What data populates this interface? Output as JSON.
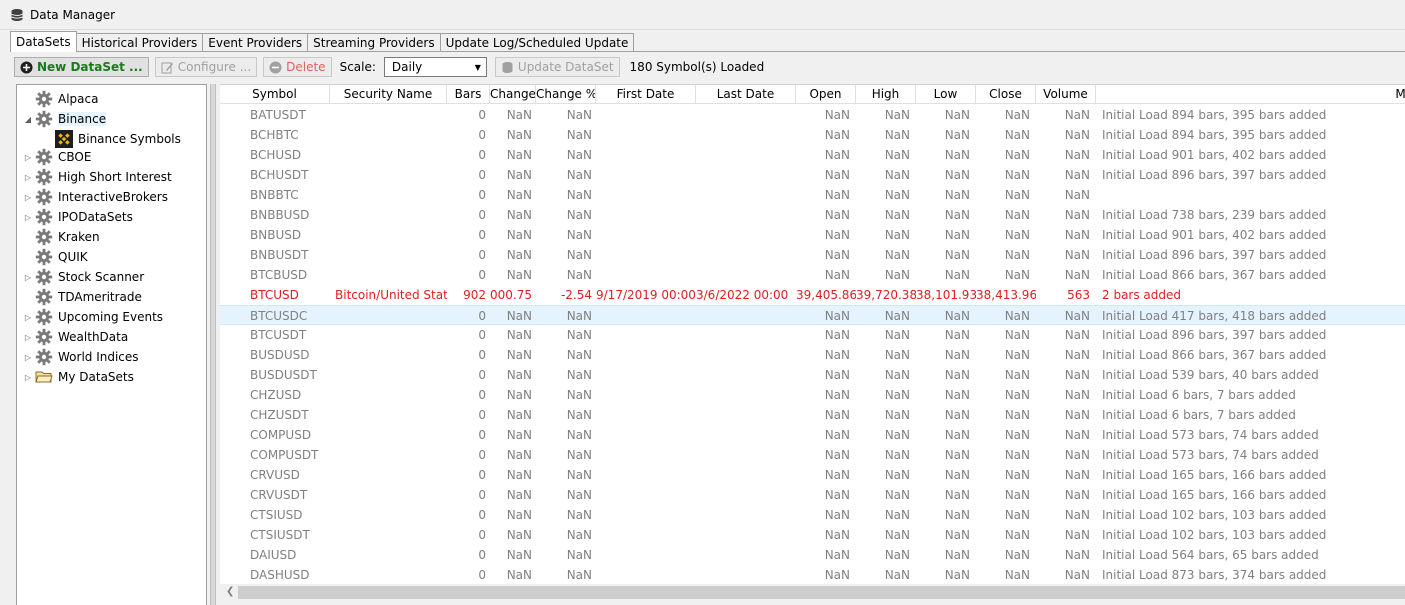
{
  "window": {
    "title": "Data Manager"
  },
  "tabs": [
    {
      "label": "DataSets",
      "active": true
    },
    {
      "label": "Historical Providers",
      "active": false
    },
    {
      "label": "Event Providers",
      "active": false
    },
    {
      "label": "Streaming Providers",
      "active": false
    },
    {
      "label": "Update Log/Scheduled Update",
      "active": false
    }
  ],
  "toolbar": {
    "new_label": "New DataSet ...",
    "configure_label": "Configure ...",
    "delete_label": "Delete",
    "scale_label": "Scale:",
    "scale_value": "Daily",
    "update_label": "Update DataSet",
    "status": "180 Symbol(s) Loaded"
  },
  "tree": {
    "items": [
      {
        "label": "Alpaca",
        "icon": "gear-icon",
        "expander": ""
      },
      {
        "label": "Binance",
        "icon": "gear-icon",
        "expander": "expanded",
        "selected": true
      },
      {
        "label": "Binance Symbols",
        "icon": "binance-logo-icon",
        "expander": "",
        "child": true
      },
      {
        "label": "CBOE",
        "icon": "gear-icon",
        "expander": "collapsed"
      },
      {
        "label": "High Short Interest",
        "icon": "gear-icon",
        "expander": "collapsed"
      },
      {
        "label": "InteractiveBrokers",
        "icon": "gear-icon",
        "expander": "collapsed"
      },
      {
        "label": "IPODataSets",
        "icon": "gear-icon",
        "expander": "collapsed"
      },
      {
        "label": "Kraken",
        "icon": "gear-icon",
        "expander": ""
      },
      {
        "label": "QUIK",
        "icon": "gear-icon",
        "expander": ""
      },
      {
        "label": "Stock Scanner",
        "icon": "gear-icon",
        "expander": "collapsed"
      },
      {
        "label": "TDAmeritrade",
        "icon": "gear-icon",
        "expander": ""
      },
      {
        "label": "Upcoming Events",
        "icon": "gear-icon",
        "expander": "collapsed"
      },
      {
        "label": "WealthData",
        "icon": "gear-icon",
        "expander": "collapsed"
      },
      {
        "label": "World Indices",
        "icon": "gear-icon",
        "expander": "collapsed"
      },
      {
        "label": "My DataSets",
        "icon": "folder-icon",
        "expander": "collapsed"
      }
    ]
  },
  "grid": {
    "columns": [
      "Symbol",
      "Security Name",
      "Bars",
      "Change",
      "Change %",
      "First Date",
      "Last Date",
      "Open",
      "High",
      "Low",
      "Close",
      "Volume",
      "Message"
    ],
    "rows": [
      {
        "symbol": "BATUSDT",
        "name": "",
        "bars": "0",
        "change": "NaN",
        "changepct": "NaN",
        "first": "",
        "last": "",
        "open": "NaN",
        "high": "NaN",
        "low": "NaN",
        "close": "NaN",
        "volume": "NaN",
        "message": "Initial Load 894 bars, 395 bars added"
      },
      {
        "symbol": "BCHBTC",
        "name": "",
        "bars": "0",
        "change": "NaN",
        "changepct": "NaN",
        "first": "",
        "last": "",
        "open": "NaN",
        "high": "NaN",
        "low": "NaN",
        "close": "NaN",
        "volume": "NaN",
        "message": "Initial Load 894 bars, 395 bars added"
      },
      {
        "symbol": "BCHUSD",
        "name": "",
        "bars": "0",
        "change": "NaN",
        "changepct": "NaN",
        "first": "",
        "last": "",
        "open": "NaN",
        "high": "NaN",
        "low": "NaN",
        "close": "NaN",
        "volume": "NaN",
        "message": "Initial Load 901 bars, 402 bars added"
      },
      {
        "symbol": "BCHUSDT",
        "name": "",
        "bars": "0",
        "change": "NaN",
        "changepct": "NaN",
        "first": "",
        "last": "",
        "open": "NaN",
        "high": "NaN",
        "low": "NaN",
        "close": "NaN",
        "volume": "NaN",
        "message": "Initial Load 896 bars, 397 bars added"
      },
      {
        "symbol": "BNBBTC",
        "name": "",
        "bars": "0",
        "change": "NaN",
        "changepct": "NaN",
        "first": "",
        "last": "",
        "open": "NaN",
        "high": "NaN",
        "low": "NaN",
        "close": "NaN",
        "volume": "NaN",
        "message": ""
      },
      {
        "symbol": "BNBBUSD",
        "name": "",
        "bars": "0",
        "change": "NaN",
        "changepct": "NaN",
        "first": "",
        "last": "",
        "open": "NaN",
        "high": "NaN",
        "low": "NaN",
        "close": "NaN",
        "volume": "NaN",
        "message": "Initial Load 738 bars, 239 bars added"
      },
      {
        "symbol": "BNBUSD",
        "name": "",
        "bars": "0",
        "change": "NaN",
        "changepct": "NaN",
        "first": "",
        "last": "",
        "open": "NaN",
        "high": "NaN",
        "low": "NaN",
        "close": "NaN",
        "volume": "NaN",
        "message": "Initial Load 901 bars, 402 bars added"
      },
      {
        "symbol": "BNBUSDT",
        "name": "",
        "bars": "0",
        "change": "NaN",
        "changepct": "NaN",
        "first": "",
        "last": "",
        "open": "NaN",
        "high": "NaN",
        "low": "NaN",
        "close": "NaN",
        "volume": "NaN",
        "message": "Initial Load 896 bars, 397 bars added"
      },
      {
        "symbol": "BTCBUSD",
        "name": "",
        "bars": "0",
        "change": "NaN",
        "changepct": "NaN",
        "first": "",
        "last": "",
        "open": "NaN",
        "high": "NaN",
        "low": "NaN",
        "close": "NaN",
        "volume": "NaN",
        "message": "Initial Load 866 bars, 367 bars added"
      },
      {
        "symbol": "BTCUSD",
        "name": "Bitcoin/United State",
        "bars": "902",
        "change": "000.75",
        "changepct": "-2.54",
        "first": "9/17/2019 00:00",
        "last": "3/6/2022 00:00",
        "open": "39,405.86",
        "high": "39,720.38",
        "low": "38,101.93",
        "close": "38,413.96",
        "volume": "563",
        "message": "2 bars added",
        "highlight": "red"
      },
      {
        "symbol": "BTCUSDC",
        "name": "",
        "bars": "0",
        "change": "NaN",
        "changepct": "NaN",
        "first": "",
        "last": "",
        "open": "NaN",
        "high": "NaN",
        "low": "NaN",
        "close": "NaN",
        "volume": "NaN",
        "message": "Initial Load 417 bars, 418 bars added",
        "selected": true
      },
      {
        "symbol": "BTCUSDT",
        "name": "",
        "bars": "0",
        "change": "NaN",
        "changepct": "NaN",
        "first": "",
        "last": "",
        "open": "NaN",
        "high": "NaN",
        "low": "NaN",
        "close": "NaN",
        "volume": "NaN",
        "message": "Initial Load 896 bars, 397 bars added"
      },
      {
        "symbol": "BUSDUSD",
        "name": "",
        "bars": "0",
        "change": "NaN",
        "changepct": "NaN",
        "first": "",
        "last": "",
        "open": "NaN",
        "high": "NaN",
        "low": "NaN",
        "close": "NaN",
        "volume": "NaN",
        "message": "Initial Load 866 bars, 367 bars added"
      },
      {
        "symbol": "BUSDUSDT",
        "name": "",
        "bars": "0",
        "change": "NaN",
        "changepct": "NaN",
        "first": "",
        "last": "",
        "open": "NaN",
        "high": "NaN",
        "low": "NaN",
        "close": "NaN",
        "volume": "NaN",
        "message": "Initial Load 539 bars, 40 bars added"
      },
      {
        "symbol": "CHZUSD",
        "name": "",
        "bars": "0",
        "change": "NaN",
        "changepct": "NaN",
        "first": "",
        "last": "",
        "open": "NaN",
        "high": "NaN",
        "low": "NaN",
        "close": "NaN",
        "volume": "NaN",
        "message": "Initial Load 6 bars, 7 bars added"
      },
      {
        "symbol": "CHZUSDT",
        "name": "",
        "bars": "0",
        "change": "NaN",
        "changepct": "NaN",
        "first": "",
        "last": "",
        "open": "NaN",
        "high": "NaN",
        "low": "NaN",
        "close": "NaN",
        "volume": "NaN",
        "message": "Initial Load 6 bars, 7 bars added"
      },
      {
        "symbol": "COMPUSD",
        "name": "",
        "bars": "0",
        "change": "NaN",
        "changepct": "NaN",
        "first": "",
        "last": "",
        "open": "NaN",
        "high": "NaN",
        "low": "NaN",
        "close": "NaN",
        "volume": "NaN",
        "message": "Initial Load 573 bars, 74 bars added"
      },
      {
        "symbol": "COMPUSDT",
        "name": "",
        "bars": "0",
        "change": "NaN",
        "changepct": "NaN",
        "first": "",
        "last": "",
        "open": "NaN",
        "high": "NaN",
        "low": "NaN",
        "close": "NaN",
        "volume": "NaN",
        "message": "Initial Load 573 bars, 74 bars added"
      },
      {
        "symbol": "CRVUSD",
        "name": "",
        "bars": "0",
        "change": "NaN",
        "changepct": "NaN",
        "first": "",
        "last": "",
        "open": "NaN",
        "high": "NaN",
        "low": "NaN",
        "close": "NaN",
        "volume": "NaN",
        "message": "Initial Load 165 bars, 166 bars added"
      },
      {
        "symbol": "CRVUSDT",
        "name": "",
        "bars": "0",
        "change": "NaN",
        "changepct": "NaN",
        "first": "",
        "last": "",
        "open": "NaN",
        "high": "NaN",
        "low": "NaN",
        "close": "NaN",
        "volume": "NaN",
        "message": "Initial Load 165 bars, 166 bars added"
      },
      {
        "symbol": "CTSIUSD",
        "name": "",
        "bars": "0",
        "change": "NaN",
        "changepct": "NaN",
        "first": "",
        "last": "",
        "open": "NaN",
        "high": "NaN",
        "low": "NaN",
        "close": "NaN",
        "volume": "NaN",
        "message": "Initial Load 102 bars, 103 bars added"
      },
      {
        "symbol": "CTSIUSDT",
        "name": "",
        "bars": "0",
        "change": "NaN",
        "changepct": "NaN",
        "first": "",
        "last": "",
        "open": "NaN",
        "high": "NaN",
        "low": "NaN",
        "close": "NaN",
        "volume": "NaN",
        "message": "Initial Load 102 bars, 103 bars added"
      },
      {
        "symbol": "DAIUSD",
        "name": "",
        "bars": "0",
        "change": "NaN",
        "changepct": "NaN",
        "first": "",
        "last": "",
        "open": "NaN",
        "high": "NaN",
        "low": "NaN",
        "close": "NaN",
        "volume": "NaN",
        "message": "Initial Load 564 bars, 65 bars added"
      },
      {
        "symbol": "DASHUSD",
        "name": "",
        "bars": "0",
        "change": "NaN",
        "changepct": "NaN",
        "first": "",
        "last": "",
        "open": "NaN",
        "high": "NaN",
        "low": "NaN",
        "close": "NaN",
        "volume": "NaN",
        "message": "Initial Load 873 bars, 374 bars added"
      }
    ]
  },
  "colors": {
    "selection": "#e5f3ff",
    "highlight_red": "#e02020",
    "dim_text": "#808080",
    "new_button_green": "#1a7a1a"
  }
}
